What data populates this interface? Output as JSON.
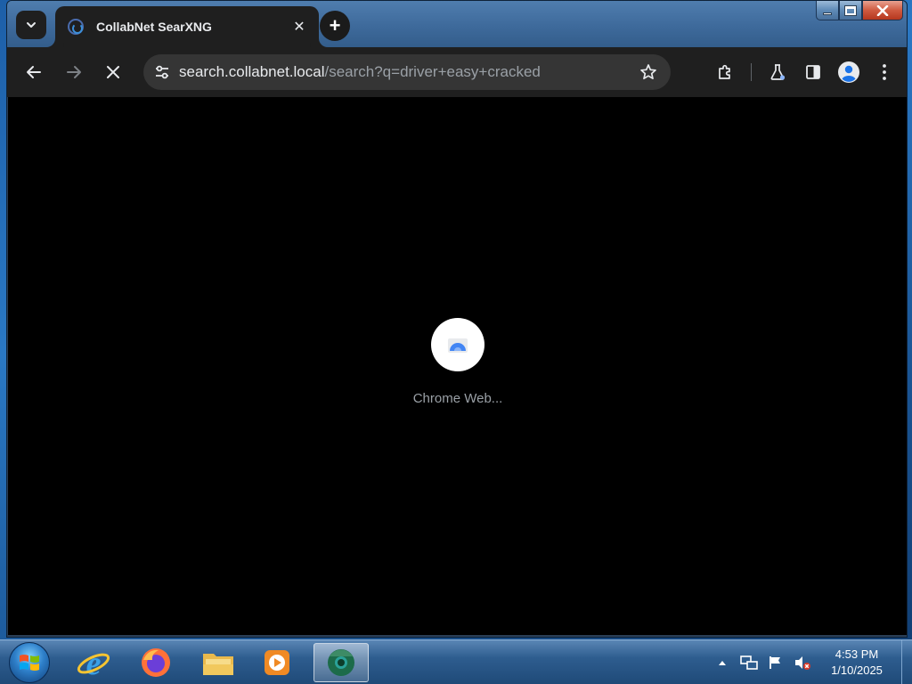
{
  "browser": {
    "tab": {
      "title": "CollabNet SearXNG",
      "close_glyph": "✕"
    },
    "new_tab_glyph": "+",
    "address": {
      "host": "search.collabnet.local",
      "path": "/search?q=driver+easy+cracked"
    },
    "loading": {
      "caption": "Chrome Web..."
    },
    "colors": {
      "toolbar": "#1f1f1f",
      "omnibox": "#353535",
      "content": "#000000"
    }
  },
  "icons": {
    "tab_search": "chevron-down-icon",
    "favicon": "searxng-favicon-icon",
    "back": "arrow-left-icon",
    "forward": "arrow-right-icon",
    "stop": "close-icon",
    "site_info": "tune-icon",
    "bookmark": "star-icon",
    "extensions": "puzzle-icon",
    "labs": "flask-icon",
    "side_panel": "side-panel-icon",
    "profile": "person-icon",
    "menu": "kebab-menu-icon"
  },
  "taskbar": {
    "apps": [
      "Internet Explorer",
      "Firefox",
      "Windows Explorer",
      "Media Player",
      "Chrome"
    ],
    "clock": {
      "time": "4:53 PM",
      "date": "1/10/2025"
    }
  }
}
